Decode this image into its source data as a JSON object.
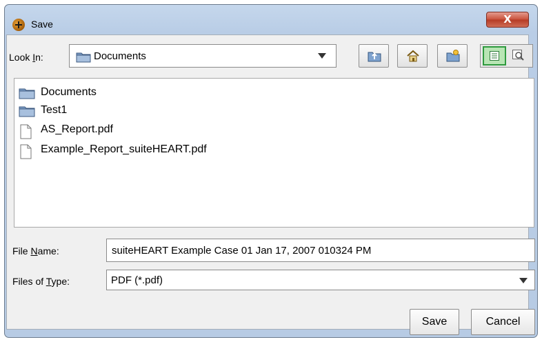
{
  "window": {
    "title": "Save",
    "close_label": "X"
  },
  "lookin": {
    "label_pre": "Look ",
    "label_mn": "I",
    "label_post": "n:",
    "value": "Documents"
  },
  "toolbar": {
    "icons": [
      "up-folder-icon",
      "home-icon",
      "new-folder-icon",
      "list-view-icon",
      "details-view-icon"
    ]
  },
  "files": [
    {
      "name": "Documents",
      "type": "folder"
    },
    {
      "name": "Test1",
      "type": "folder"
    },
    {
      "name": "AS_Report.pdf",
      "type": "file"
    },
    {
      "name": "Example_Report_suiteHEART.pdf",
      "type": "file"
    }
  ],
  "file_name": {
    "label_pre": "File ",
    "label_mn": "N",
    "label_post": "ame:",
    "value": "suiteHEART Example Case 01 Jan 17, 2007 010324 PM"
  },
  "file_type": {
    "label_pre": "Files of ",
    "label_mn": "T",
    "label_post": "ype:",
    "value": "PDF (*.pdf)"
  },
  "buttons": {
    "save": "Save",
    "cancel": "Cancel"
  },
  "colors": {
    "titlebar": "#b9cde6",
    "close": "#c9503a",
    "folder": "#7a9bc3",
    "view_active": "#2e9a3e"
  }
}
